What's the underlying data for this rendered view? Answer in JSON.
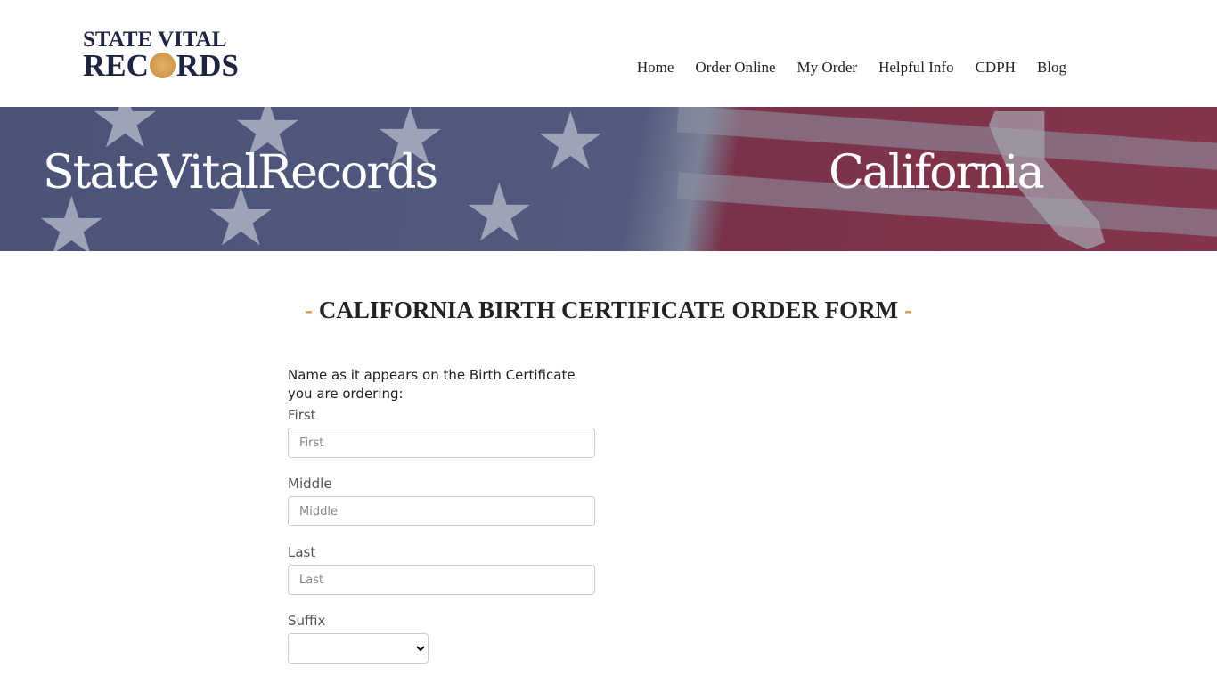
{
  "logo": {
    "line1": "STATE VITAL",
    "line2a": "REC",
    "line2b": "RDS"
  },
  "nav": [
    "Home",
    "Order Online",
    "My Order",
    "Helpful Info",
    "CDPH",
    "Blog"
  ],
  "banner": {
    "left": "StateVitalRecords",
    "right": "California"
  },
  "title": {
    "dash": "-",
    "text": "CALIFORNIA BIRTH CERTIFICATE ORDER FORM"
  },
  "form": {
    "intro": "Name as it appears on the Birth Certificate you are ordering:",
    "first": {
      "label": "First",
      "placeholder": "First"
    },
    "middle": {
      "label": "Middle",
      "placeholder": "Middle"
    },
    "last": {
      "label": "Last",
      "placeholder": "Last"
    },
    "suffix": {
      "label": "Suffix",
      "value": ""
    }
  },
  "colors": {
    "accent": "#d79b4a",
    "navy": "#1f2440"
  }
}
